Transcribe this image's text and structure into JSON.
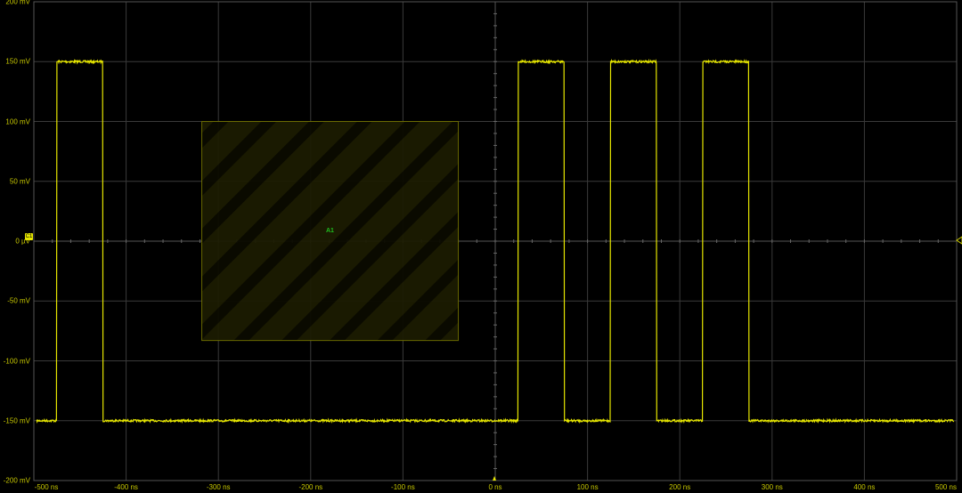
{
  "display": {
    "trace_color": "#e6e600",
    "grid_color": "#3a3a3a",
    "axis_label_color": "#c8c800",
    "zone_label_color": "#1fbf1f"
  },
  "y_axis": {
    "unit": "mV",
    "range": [
      -200,
      200
    ],
    "labels": [
      "200 mV",
      "150 mV",
      "100 mV",
      "50 mV",
      "0 µV",
      "-50 mV",
      "-100 mV",
      "-150 mV",
      "-200 mV"
    ],
    "values": [
      200,
      150,
      100,
      50,
      0,
      -50,
      -100,
      -150,
      -200
    ]
  },
  "x_axis": {
    "unit": "ns",
    "range": [
      -500,
      500
    ],
    "labels": [
      "-500 ns",
      "-400 ns",
      "-300 ns",
      "-200 ns",
      "-100 ns",
      "0 ns",
      "100 ns",
      "200 ns",
      "300 ns",
      "400 ns",
      "500 ns"
    ],
    "values": [
      -500,
      -400,
      -300,
      -200,
      -100,
      0,
      100,
      200,
      300,
      400,
      500
    ]
  },
  "channel_marker": "C1",
  "signal": {
    "low_mv": -150,
    "high_mv": 150,
    "pulses_ns": [
      [
        -475,
        -425
      ],
      [
        25,
        75
      ],
      [
        125,
        175
      ],
      [
        225,
        275
      ]
    ]
  },
  "zone": {
    "label": "A1",
    "x_ns": [
      -318,
      -40
    ],
    "y_mv": [
      100,
      -83
    ]
  }
}
